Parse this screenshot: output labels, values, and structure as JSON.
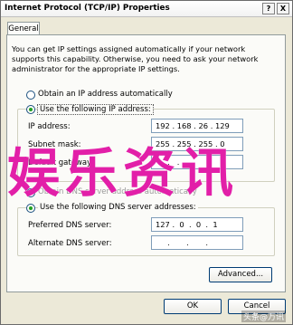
{
  "window": {
    "title": "Internet Protocol (TCP/IP) Properties",
    "help_btn": "?",
    "close_btn": "X"
  },
  "tabs": [
    {
      "label": "General"
    }
  ],
  "description": "You can get IP settings assigned automatically if your network supports this capability. Otherwise, you need to ask your network administrator for the appropriate IP settings.",
  "ip_section": {
    "auto_label": "Obtain an IP address automatically",
    "manual_label": "Use the following IP address:",
    "ip_label": "IP address:",
    "ip_value": "192 . 168 . 26 . 129",
    "subnet_label": "Subnet mask:",
    "subnet_value": "255 . 255 . 255 . 0",
    "gateway_label": "Default gateway:",
    "gateway_value": " .   .   . "
  },
  "dns_section": {
    "auto_label": "Obtain DNS server address automatically",
    "manual_label": "Use the following DNS server addresses:",
    "preferred_label": "Preferred DNS server:",
    "preferred_value": "127 .  0  .  0  .  1",
    "alternate_label": "Alternate DNS server:",
    "alternate_value": "     .       .       . "
  },
  "buttons": {
    "advanced": "Advanced...",
    "ok": "OK",
    "cancel": "Cancel"
  },
  "overlay_text": "娱乐资讯",
  "watermark": "头条@万讯"
}
